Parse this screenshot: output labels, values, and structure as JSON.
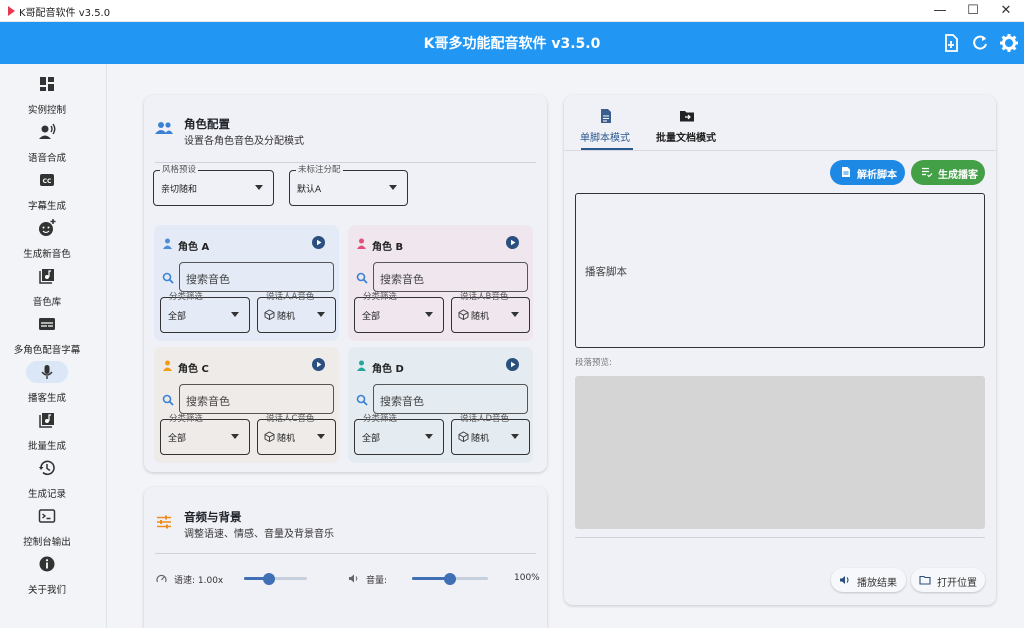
{
  "window": {
    "title": "K哥配音软件 v3.5.0",
    "buttons": [
      "—",
      "☐",
      "✕"
    ]
  },
  "app": {
    "title": "K哥多功能配音软件 v3.5.0"
  },
  "colors": {
    "primary": "#2196f3",
    "green": "#43a047",
    "blue_btn": "#1e88e5"
  },
  "sidebar": {
    "items": [
      {
        "label": "实例控制",
        "icon": "dashboard-icon"
      },
      {
        "label": "语音合成",
        "icon": "voice-icon"
      },
      {
        "label": "字幕生成",
        "icon": "cc-icon"
      },
      {
        "label": "生成新音色",
        "icon": "add-emoji-icon"
      },
      {
        "label": "音色库",
        "icon": "library-icon"
      },
      {
        "label": "多角色配音字幕",
        "icon": "subtitles-icon"
      },
      {
        "label": "播客生成",
        "icon": "mic-icon",
        "active": true
      },
      {
        "label": "批量生成",
        "icon": "batch-icon"
      },
      {
        "label": "生成记录",
        "icon": "history-icon"
      },
      {
        "label": "控制台输出",
        "icon": "terminal-icon"
      },
      {
        "label": "关于我们",
        "icon": "info-icon"
      }
    ]
  },
  "roles_card": {
    "title": "角色配置",
    "subtitle": "设置各角色音色及分配模式",
    "style_preset": {
      "legend": "风格预设",
      "value": "亲切随和"
    },
    "unassigned": {
      "legend": "未标注分配",
      "value": "默认A"
    },
    "roles": [
      {
        "name": "角色 A",
        "search_placeholder": "搜索音色",
        "category_legend": "分类筛选",
        "category_value": "全部",
        "speaker_legend": "说话人A音色",
        "speaker_value": "随机",
        "accent": "#4a8fd8",
        "bg": "#e4ebf6"
      },
      {
        "name": "角色 B",
        "search_placeholder": "搜索音色",
        "category_legend": "分类筛选",
        "category_value": "全部",
        "speaker_legend": "说话人B音色",
        "speaker_value": "随机",
        "accent": "#e0507a",
        "bg": "#efe6ee"
      },
      {
        "name": "角色 C",
        "search_placeholder": "搜索音色",
        "category_legend": "分类筛选",
        "category_value": "全部",
        "speaker_legend": "说话人C音色",
        "speaker_value": "随机",
        "accent": "#f39c12",
        "bg": "#efebe9"
      },
      {
        "name": "角色 D",
        "search_placeholder": "搜索音色",
        "category_legend": "分类筛选",
        "category_value": "全部",
        "speaker_legend": "说话人D音色",
        "speaker_value": "随机",
        "accent": "#26a69a",
        "bg": "#e4ebf1"
      }
    ]
  },
  "audio_card": {
    "title": "音频与背景",
    "subtitle": "调整语速、情感、音量及背景音乐",
    "speed_label": "语速: 1.00x",
    "speed_value": 0.4,
    "volume_label": "音量:",
    "volume_value": 0.5,
    "volume_text": "100%"
  },
  "script_card": {
    "tabs": [
      "单脚本模式",
      "批量文档模式"
    ],
    "active_tab": 0,
    "parse_button": "解析脚本",
    "generate_button": "生成播客",
    "script_placeholder": "播客脚本",
    "preview_label": "段落预览:",
    "play_button": "播放结果",
    "open_button": "打开位置"
  }
}
